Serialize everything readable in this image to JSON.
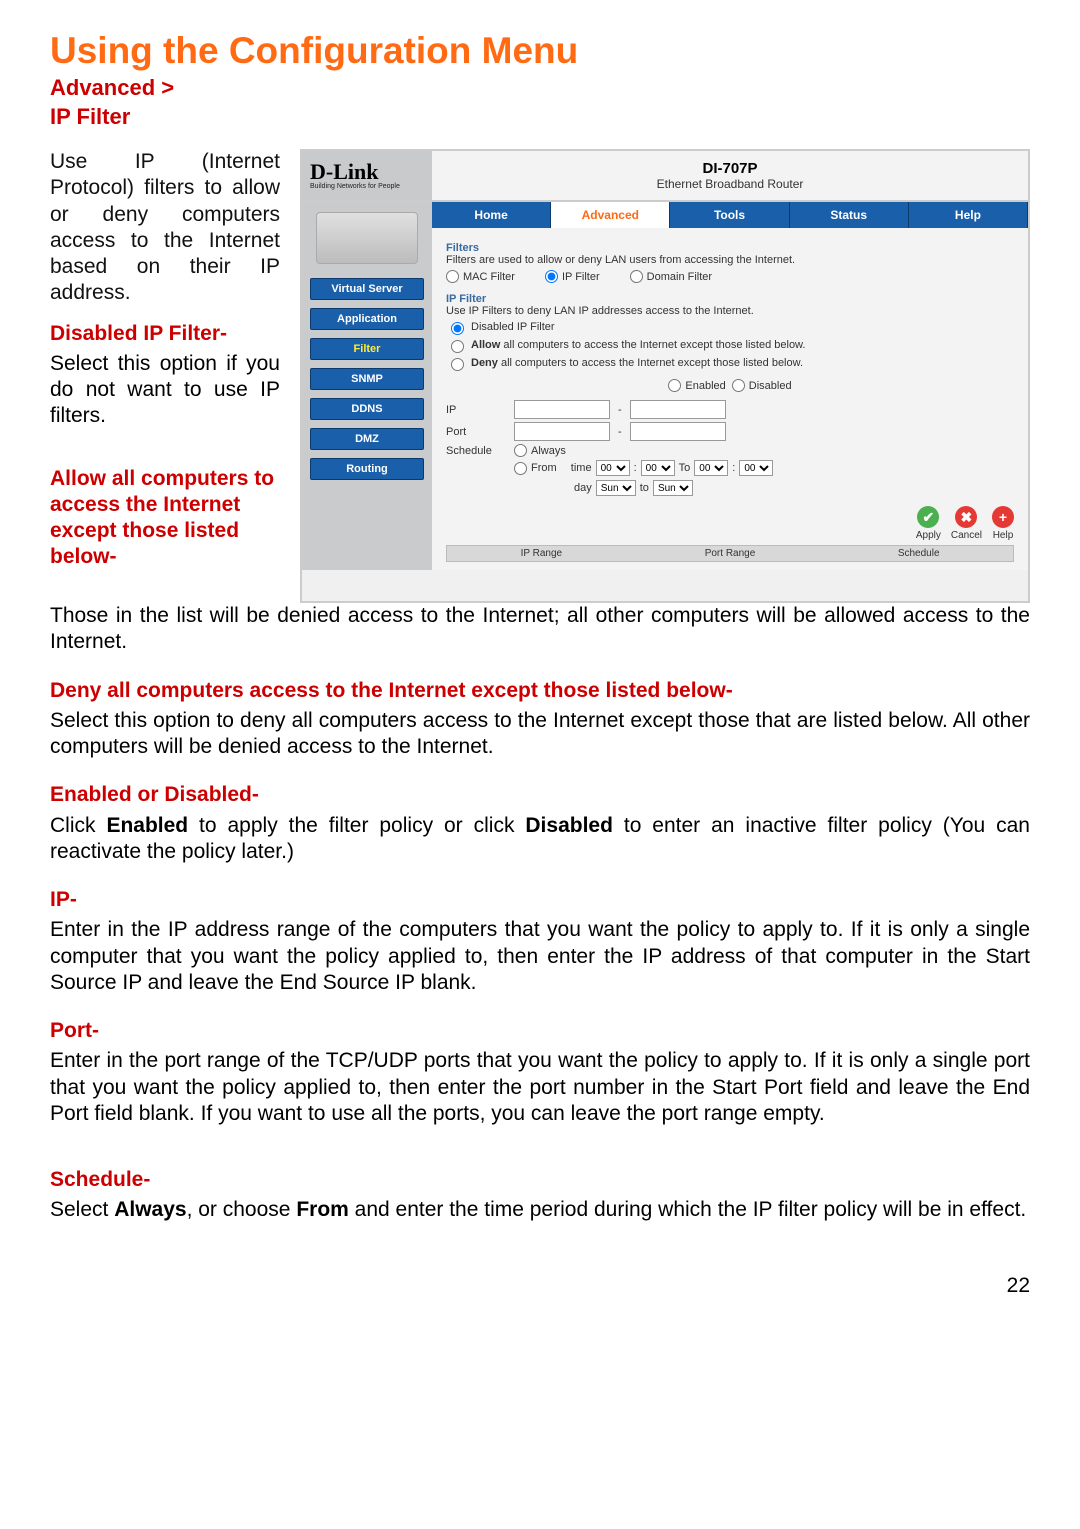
{
  "title": "Using the Configuration Menu",
  "breadcrumb_line1": "Advanced >",
  "breadcrumb_line2": "IP Filter",
  "intro": "Use IP (Internet Protocol) filters to allow or deny computers access to the Internet based on their IP address.",
  "sections": {
    "disabled_head": "Disabled IP Filter-",
    "disabled_body": "Select this option if you do not want to use IP filters.",
    "allow_head": "Allow all computers to access the Internet except those listed below-",
    "allow_body": "Those in the list will be denied access to the Internet; all other computers will be allowed access to the Internet.",
    "deny_head": "Deny  all computers access to the Internet except those listed below-",
    "deny_body": "Select this option to deny all computers access to the Internet except those that are listed below.  All other computers will be denied access to the Internet.",
    "enabled_head": "Enabled or Disabled-",
    "enabled_body_pre": "Click ",
    "enabled_bold1": "Enabled",
    "enabled_body_mid": " to apply the filter policy or click ",
    "enabled_bold2": "Disabled",
    "enabled_body_post": " to enter an inactive filter policy (You can reactivate the policy later.)",
    "ip_head": "IP-",
    "ip_body": "Enter in the IP address range of the computers that you want the policy to apply to.  If it is only a single computer that you want the policy applied to, then enter the IP address of that computer in the Start Source IP and leave the End Source IP blank.",
    "port_head": "Port-",
    "port_body": "Enter in the port range of the TCP/UDP ports that you want the policy to apply to.  If it is only a single port  that you want the policy applied to, then enter the port number in the Start Port  field and leave the End Port field blank.  If you want to use all the ports, you can leave the port range empty.",
    "schedule_head": "Schedule-",
    "schedule_pre": "Select ",
    "schedule_bold1": "Always",
    "schedule_mid": ", or choose ",
    "schedule_bold2": "From",
    "schedule_post": " and enter the time period during which the IP filter policy will be in effect."
  },
  "page_number": "22",
  "router": {
    "brand": "D-Link",
    "brand_tag": "Building Networks for People",
    "model": "DI-707P",
    "subtitle": "Ethernet Broadband Router",
    "tabs": [
      "Home",
      "Advanced",
      "Tools",
      "Status",
      "Help"
    ],
    "active_tab": "Advanced",
    "side_items": [
      "Virtual Server",
      "Application",
      "Filter",
      "SNMP",
      "DDNS",
      "DMZ",
      "Routing"
    ],
    "side_active": "Filter",
    "filters_title": "Filters",
    "filters_desc": "Filters are used to allow or deny LAN users from accessing the Internet.",
    "filter_type_opts": [
      "MAC Filter",
      "IP Filter",
      "Domain Filter"
    ],
    "filter_type_selected": "IP Filter",
    "ipfilter_title": "IP Filter",
    "ipfilter_desc": "Use IP Filters to deny LAN IP addresses access to the Internet.",
    "policy_opts": {
      "disabled": "Disabled IP Filter",
      "allow": "Allow all computers to access the Internet except those listed below.",
      "deny": "Deny all computers to access the Internet except those listed below."
    },
    "policy_selected": "disabled",
    "state_opts": [
      "Enabled",
      "Disabled"
    ],
    "labels": {
      "ip": "IP",
      "port": "Port",
      "schedule": "Schedule",
      "always": "Always",
      "from": "From",
      "time": "time",
      "to_cap": "To",
      "day": "day",
      "to_low": "to"
    },
    "time_opts": [
      "00"
    ],
    "day_opts": [
      "Sun"
    ],
    "actions": {
      "apply": "Apply",
      "cancel": "Cancel",
      "help": "Help"
    },
    "table_heads": [
      "IP Range",
      "Port Range",
      "Schedule"
    ]
  }
}
